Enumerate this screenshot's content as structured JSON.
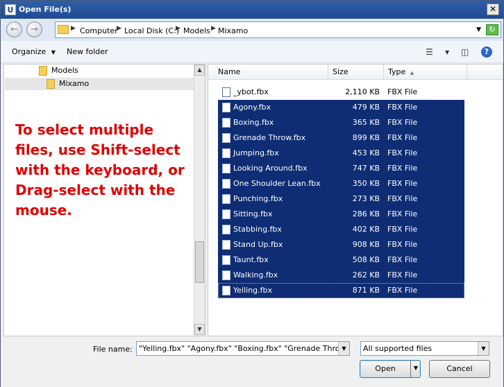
{
  "window": {
    "title": "Open File(s)",
    "app_icon_letter": "U",
    "close_glyph": "✕"
  },
  "address": {
    "crumbs": [
      "Computer",
      "Local Disk (C:)",
      "Models",
      "Mixamo"
    ]
  },
  "toolbar": {
    "organize_label": "Organize",
    "new_folder_label": "New folder",
    "help_glyph": "?"
  },
  "nav_pane": {
    "items": [
      {
        "label": "Models"
      },
      {
        "label": "Mixamo"
      }
    ],
    "callout_text": "To select multiple files, use Shift-select with the keyboard, or Drag-select with the mouse."
  },
  "files": {
    "columns": {
      "name": "Name",
      "size": "Size",
      "type": "Type"
    },
    "rows": [
      {
        "name": "_ybot.fbx",
        "size": "2,110 KB",
        "type": "FBX File",
        "selected": false
      },
      {
        "name": "Agony.fbx",
        "size": "479 KB",
        "type": "FBX File",
        "selected": true
      },
      {
        "name": "Boxing.fbx",
        "size": "365 KB",
        "type": "FBX File",
        "selected": true
      },
      {
        "name": "Grenade Throw.fbx",
        "size": "899 KB",
        "type": "FBX File",
        "selected": true
      },
      {
        "name": "Jumping.fbx",
        "size": "453 KB",
        "type": "FBX File",
        "selected": true
      },
      {
        "name": "Looking Around.fbx",
        "size": "747 KB",
        "type": "FBX File",
        "selected": true
      },
      {
        "name": "One Shoulder Lean.fbx",
        "size": "350 KB",
        "type": "FBX File",
        "selected": true
      },
      {
        "name": "Punching.fbx",
        "size": "273 KB",
        "type": "FBX File",
        "selected": true
      },
      {
        "name": "Sitting.fbx",
        "size": "286 KB",
        "type": "FBX File",
        "selected": true
      },
      {
        "name": "Stabbing.fbx",
        "size": "402 KB",
        "type": "FBX File",
        "selected": true
      },
      {
        "name": "Stand Up.fbx",
        "size": "908 KB",
        "type": "FBX File",
        "selected": true
      },
      {
        "name": "Taunt.fbx",
        "size": "508 KB",
        "type": "FBX File",
        "selected": true
      },
      {
        "name": "Walking.fbx",
        "size": "262 KB",
        "type": "FBX File",
        "selected": true
      },
      {
        "name": "Yelling.fbx",
        "size": "871 KB",
        "type": "FBX File",
        "selected": true
      }
    ]
  },
  "bottom": {
    "file_name_label": "File name:",
    "file_name_value": "\"Yelling.fbx\" \"Agony.fbx\" \"Boxing.fbx\" \"Grenade Thro",
    "file_type_value": "All supported files",
    "open_label": "Open",
    "cancel_label": "Cancel"
  },
  "colors": {
    "selection": "#0e2d74",
    "callout": "#e00000"
  }
}
